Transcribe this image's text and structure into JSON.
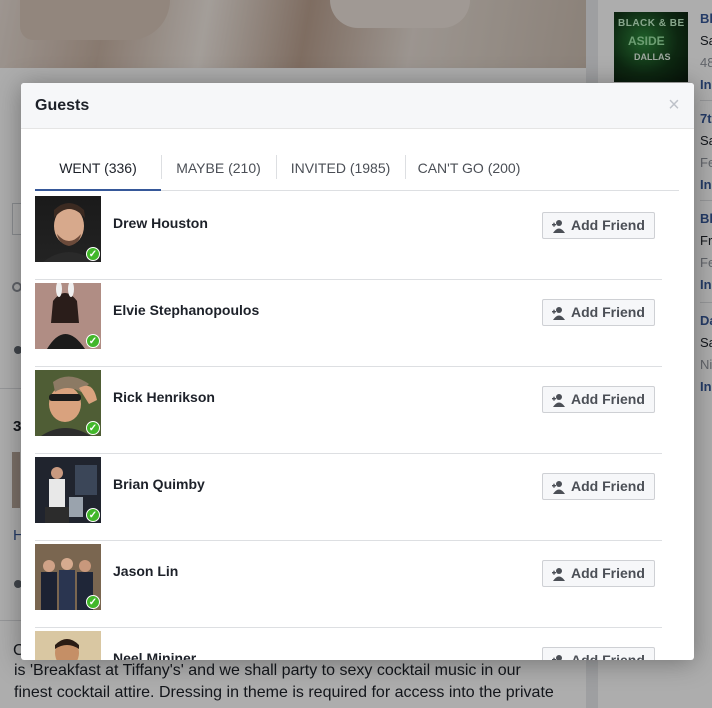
{
  "background": {
    "side_events": [
      {
        "title": "Bl",
        "line1": "Sa",
        "line2": "48",
        "action": "In"
      },
      {
        "title": "7t",
        "line1": "Sa",
        "line2": "Fe",
        "action": "In"
      },
      {
        "title": "Bl",
        "line1": "Fr",
        "line2": "Fe",
        "action": "In"
      },
      {
        "title": "Da",
        "line1": "Sa",
        "line2": "Ni",
        "action": "In"
      }
    ],
    "thumb_text": {
      "line1": "BLACK & BE",
      "line2": "ASIDE",
      "line3": "DALLAS"
    },
    "left_fragments": {
      "count": "3",
      "link": "H",
      "desc_start": "C"
    },
    "description_line1": "is 'Breakfast at Tiffany's' and we shall party to sexy cocktail music in our",
    "description_line2": "finest cocktail attire. Dressing in theme is required for access into the private"
  },
  "modal": {
    "title": "Guests",
    "close_label": "×",
    "tabs": [
      {
        "label": "WENT (336)",
        "active": true
      },
      {
        "label": "MAYBE (210)",
        "active": false
      },
      {
        "label": "INVITED (1985)",
        "active": false
      },
      {
        "label": "CAN'T GO (200)",
        "active": false
      }
    ],
    "guests": [
      {
        "name": "Drew Houston",
        "button": "Add Friend"
      },
      {
        "name": "Elvie Stephanopoulos",
        "button": "Add Friend"
      },
      {
        "name": "Rick Henrikson",
        "button": "Add Friend"
      },
      {
        "name": "Brian Quimby",
        "button": "Add Friend"
      },
      {
        "name": "Jason Lin",
        "button": "Add Friend"
      },
      {
        "name": "Neel Mininer",
        "button": "Add Friend"
      }
    ],
    "going_check": "✓"
  },
  "colors": {
    "accent": "#365899",
    "check_green": "#42b72a"
  }
}
